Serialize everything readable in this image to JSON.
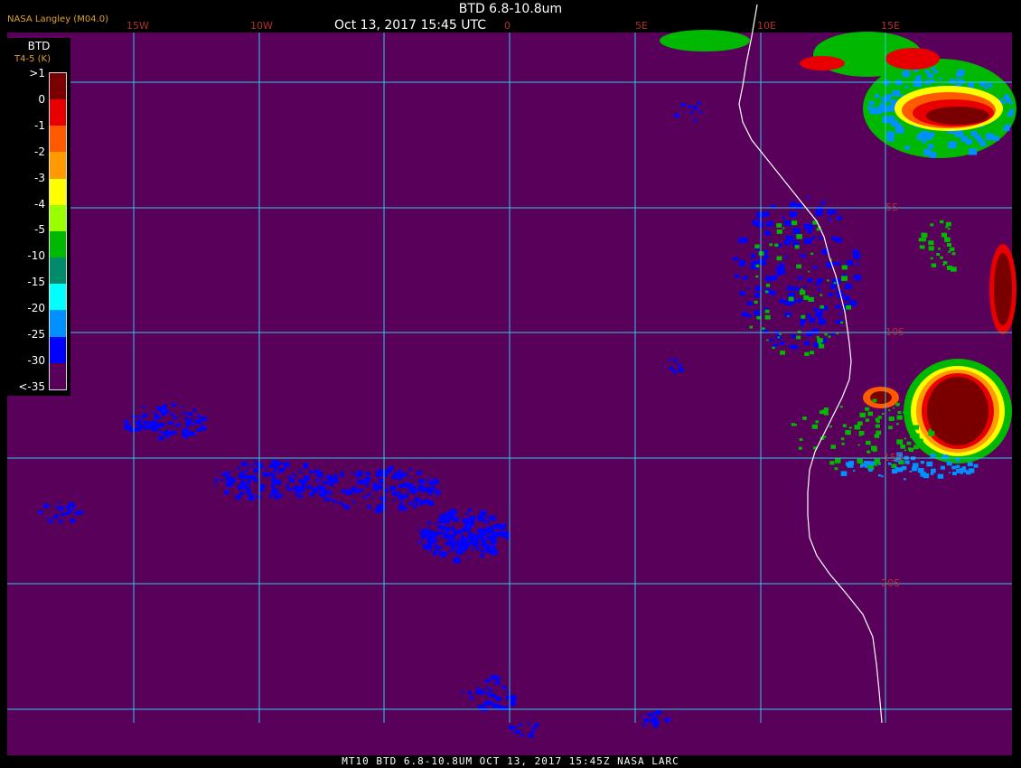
{
  "header": {
    "title": "BTD 6.8-10.8um",
    "timestamp": "Oct 13, 2017 15:45 UTC",
    "agency": "NASA Langley (M04.0)"
  },
  "legend": {
    "title": "BTD",
    "units": "T4-5 (K)",
    "levels": [
      ">1",
      "0",
      "-1",
      "-2",
      "-3",
      "-4",
      "-5",
      "-10",
      "-15",
      "-20",
      "-25",
      "-30",
      "<-35"
    ],
    "colors": [
      "#7a0000",
      "#e80000",
      "#ff5a00",
      "#ff9a00",
      "#ffff00",
      "#9aff00",
      "#00b800",
      "#008c6a",
      "#00ffff",
      "#0090ff",
      "#0000ff",
      "#58005a"
    ]
  },
  "map": {
    "background": "#58005a",
    "grid_color": "#30c8e8",
    "coast_color": "#ffffff",
    "lon_labels": [
      "15W",
      "10W",
      "0",
      "5E",
      "10E",
      "15E"
    ],
    "lat_labels": [
      "5S",
      "10S",
      "15S",
      "20S"
    ]
  },
  "footer": {
    "text": "MT10  BTD 6.8-10.8UM   OCT 13, 2017 15:45Z   NASA LARC"
  }
}
